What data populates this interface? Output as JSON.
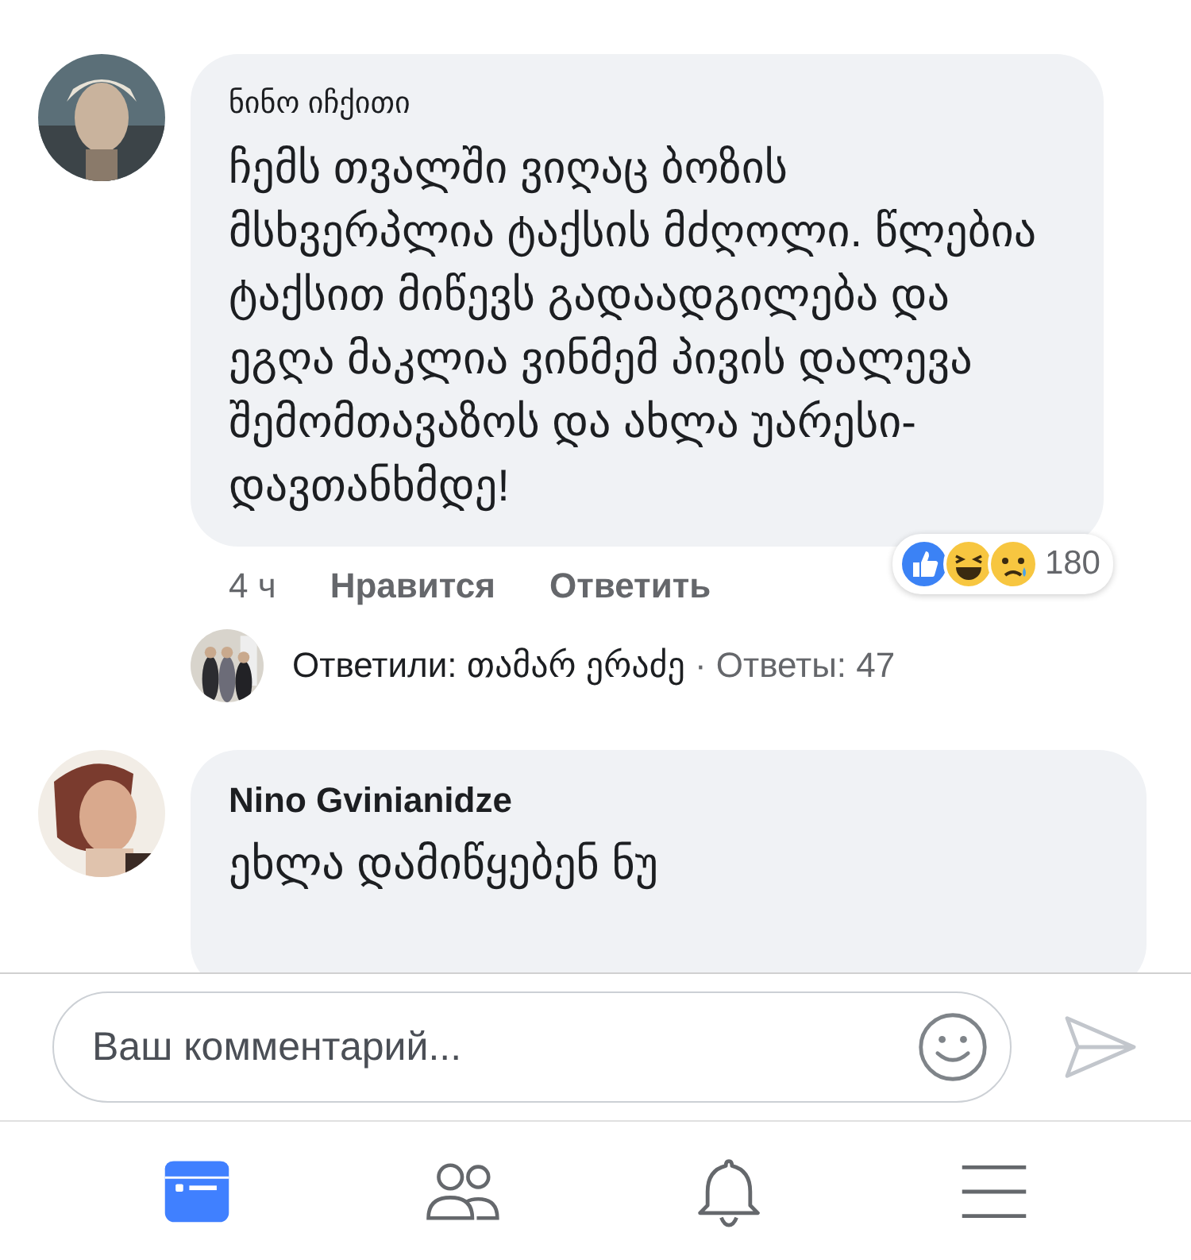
{
  "comments": [
    {
      "author": "ნინო იჩქითი",
      "text": "ჩემს თვალში ვიღაც ბოზის მსხვერპლია ტაქსის მძღოლი. წლებია ტაქსით მიწევს გადაადგილება და ეგღა მაკლია ვინმემ პივის დალევა შემომთავაზოს და ახლა უარესი-დავთანხმდე!",
      "time": "4 ч",
      "actions": [
        "Нравится",
        "Ответить"
      ],
      "reactions": {
        "count": "180"
      },
      "replies": {
        "label": "Ответили: თამარ ერაძე",
        "count": "· Ответы: 47"
      }
    },
    {
      "author": "Nino Gvinianidze",
      "text": "ეხლა დამიწყებენ ნუ"
    }
  ],
  "composer": {
    "placeholder": "Ваш комментарий..."
  },
  "tab_bar": {
    "tabs": [
      {
        "kind": "feed",
        "selected": true
      },
      {
        "kind": "friends",
        "selected": false
      },
      {
        "kind": "notifications",
        "selected": false
      },
      {
        "kind": "menu",
        "selected": false
      }
    ]
  }
}
